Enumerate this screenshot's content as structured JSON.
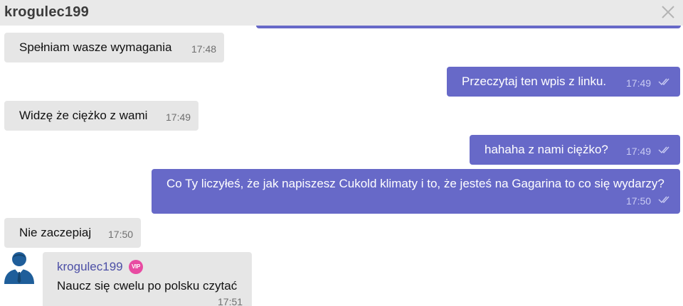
{
  "header": {
    "title": "krogulec199",
    "close_icon": "close-icon"
  },
  "colors": {
    "outgoing_bubble": "#6769c8",
    "incoming_bubble": "#e6e6e6",
    "header_bg": "#e9e9e9",
    "vip_badge": "#e84ba2",
    "sender_name": "#4c4fa6"
  },
  "messages": [
    {
      "direction": "in",
      "text": "Spełniam wasze wymagania",
      "time": "17:48"
    },
    {
      "direction": "out",
      "text": "Przeczytaj ten wpis z linku.",
      "time": "17:49",
      "read": true
    },
    {
      "direction": "in",
      "text": "Widzę że ciężko z wami",
      "time": "17:49"
    },
    {
      "direction": "out",
      "text": "hahaha z nami ciężko?",
      "time": "17:49",
      "read": true
    },
    {
      "direction": "out",
      "text": "Co Ty liczyłeś, że jak napiszesz Cukold klimaty i to, że jesteś na Gagarina to co się wydarzy?",
      "time": "17:50",
      "read": true
    },
    {
      "direction": "in",
      "text": "Nie zaczepiaj",
      "time": "17:50"
    }
  ],
  "last_message": {
    "sender": "krogulec199",
    "badge": "VIP",
    "text": "Naucz się cwelu po polsku czytać",
    "time": "17:51",
    "avatar_icon": "user-avatar-icon"
  }
}
